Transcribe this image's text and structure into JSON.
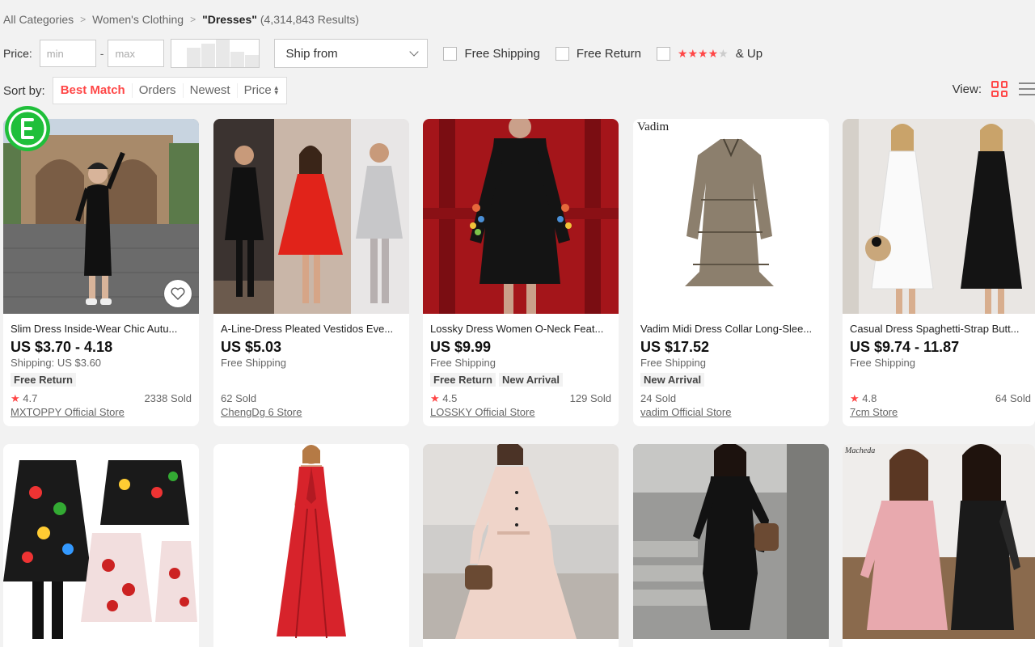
{
  "breadcrumb": {
    "items": [
      "All Categories",
      "Women's Clothing"
    ],
    "query": "\"Dresses\"",
    "count": "(4,314,843 Results)"
  },
  "filters": {
    "price_label": "Price:",
    "min_placeholder": "min",
    "max_placeholder": "max",
    "dash": "-",
    "ship_from": "Ship from",
    "free_shipping": "Free Shipping",
    "free_return": "Free Return",
    "rating_and_up": "& Up"
  },
  "sort": {
    "label": "Sort by:",
    "options": [
      "Best Match",
      "Orders",
      "Newest",
      "Price"
    ],
    "active": "Best Match"
  },
  "view": {
    "label": "View:",
    "mode": "grid-icon"
  },
  "colors": {
    "accent": "#ff4747",
    "page_bg": "#f2f2f2"
  },
  "products": [
    {
      "title": "Slim Dress Inside-Wear Chic Autu...",
      "price": "US $3.70 - 4.18",
      "shipping": "Shipping: US $3.60",
      "tags": [
        "Free Return"
      ],
      "rating": "4.7",
      "sold": "2338 Sold",
      "store": "MXTOPPY Official Store"
    },
    {
      "title": "A-Line-Dress Pleated Vestidos Eve...",
      "price": "US $5.03",
      "shipping": "Free Shipping",
      "tags": [],
      "rating": "",
      "sold": "62 Sold",
      "store": "ChengDg 6 Store"
    },
    {
      "title": "Lossky Dress Women O-Neck Feat...",
      "price": "US $9.99",
      "shipping": "Free Shipping",
      "tags": [
        "Free Return",
        "New Arrival"
      ],
      "rating": "4.5",
      "sold": "129 Sold",
      "store": "LOSSKY Official Store"
    },
    {
      "title": "Vadim Midi Dress Collar Long-Slee...",
      "price": "US $17.52",
      "shipping": "Free Shipping",
      "tags": [
        "New Arrival"
      ],
      "rating": "",
      "sold": "24 Sold",
      "store": "vadim Official Store",
      "image_text": "Vadim"
    },
    {
      "title": "Casual Dress Spaghetti-Strap Butt...",
      "price": "US $9.74 - 11.87",
      "shipping": "Free Shipping",
      "tags": [],
      "rating": "4.8",
      "sold": "64 Sold",
      "store": "7cm Store"
    }
  ],
  "image_watermarks": {
    "row2_card5": "Macheda"
  }
}
